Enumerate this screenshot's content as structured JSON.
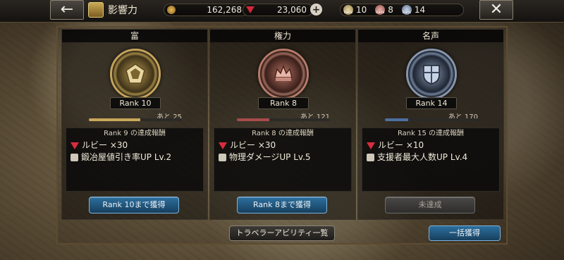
{
  "header": {
    "title": "影響力",
    "coins": "162,268",
    "rubies": "23,060",
    "ranks": [
      {
        "label": "Rank",
        "value": "10",
        "color": "#c9b37a"
      },
      {
        "label": "Rank",
        "value": "8",
        "color": "#b66f64"
      },
      {
        "label": "Rank",
        "value": "14",
        "color": "#8f9cb3"
      }
    ]
  },
  "panels": [
    {
      "header": "富",
      "rank_label": "Rank 10",
      "ato": "あと 25",
      "progress_color": "#c9a75a",
      "progress_fraction": 0.55,
      "reward_title": "Rank 9 の達成報酬",
      "reward_ruby": "ルビー ×30",
      "reward_skill": "鍛冶屋値引き率UP Lv.2",
      "button": "Rank 10まで獲得",
      "enabled": true
    },
    {
      "header": "権力",
      "rank_label": "Rank 8",
      "ato": "あと 121",
      "progress_color": "#a74b4b",
      "progress_fraction": 0.35,
      "reward_title": "Rank 8 の達成報酬",
      "reward_ruby": "ルビー ×30",
      "reward_skill": "物理ダメージUP Lv.5",
      "button": "Rank 8まで獲得",
      "enabled": true
    },
    {
      "header": "名声",
      "rank_label": "Rank 14",
      "ato": "あと 170",
      "progress_color": "#4e6fa0",
      "progress_fraction": 0.25,
      "reward_title": "Rank 15 の達成報酬",
      "reward_ruby": "ルビー ×10",
      "reward_skill": "支援者最大人数UP Lv.4",
      "button": "未達成",
      "enabled": false
    }
  ],
  "footer": {
    "ability_list": "トラベラーアビリティ一覧",
    "collect_all": "一括獲得"
  },
  "icons": [
    "back-arrow-icon",
    "close-icon",
    "coin-icon",
    "ruby-icon",
    "plus-icon",
    "wealth-emblem-icon",
    "power-emblem-icon",
    "fame-emblem-icon"
  ]
}
